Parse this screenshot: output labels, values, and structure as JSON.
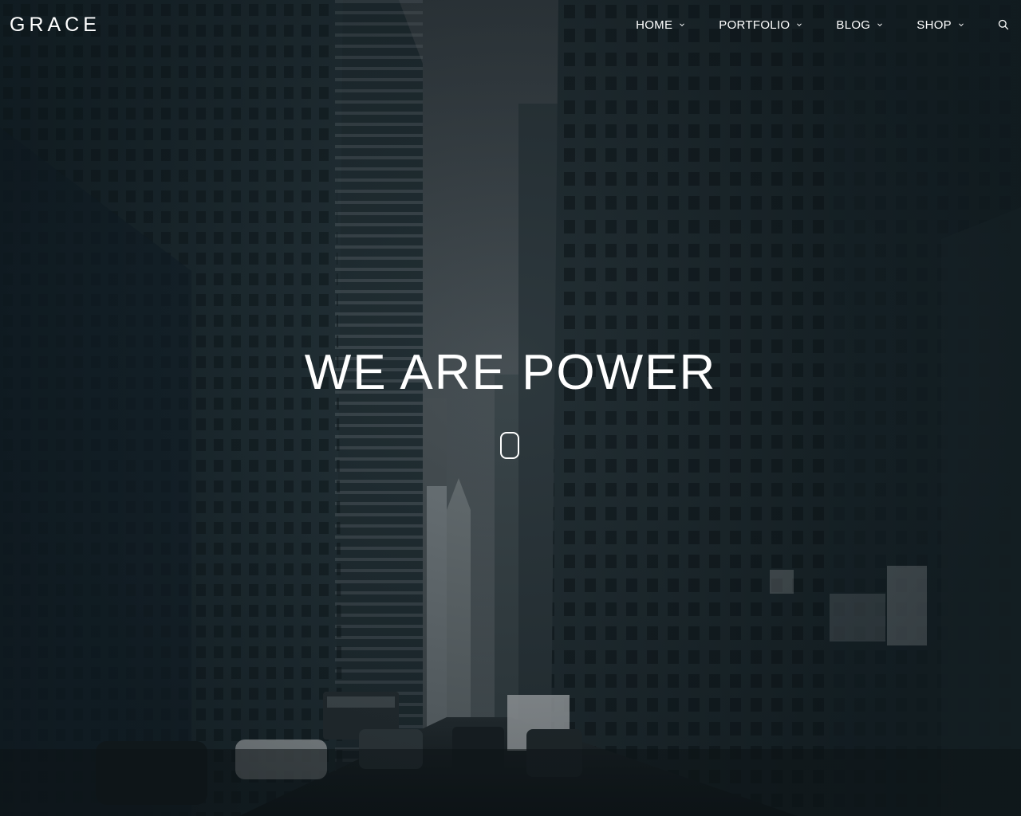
{
  "header": {
    "logo": "GRACE",
    "nav": [
      {
        "label": "HOME"
      },
      {
        "label": "PORTFOLIO"
      },
      {
        "label": "BLOG"
      },
      {
        "label": "SHOP"
      }
    ],
    "search_icon": "search-icon",
    "caret_icon": "chevron-down-icon"
  },
  "hero": {
    "headline": "WE ARE POWER",
    "scroll_icon": "mouse-scroll-icon"
  },
  "colors": {
    "text": "#ffffff",
    "background": "#1f282d"
  }
}
